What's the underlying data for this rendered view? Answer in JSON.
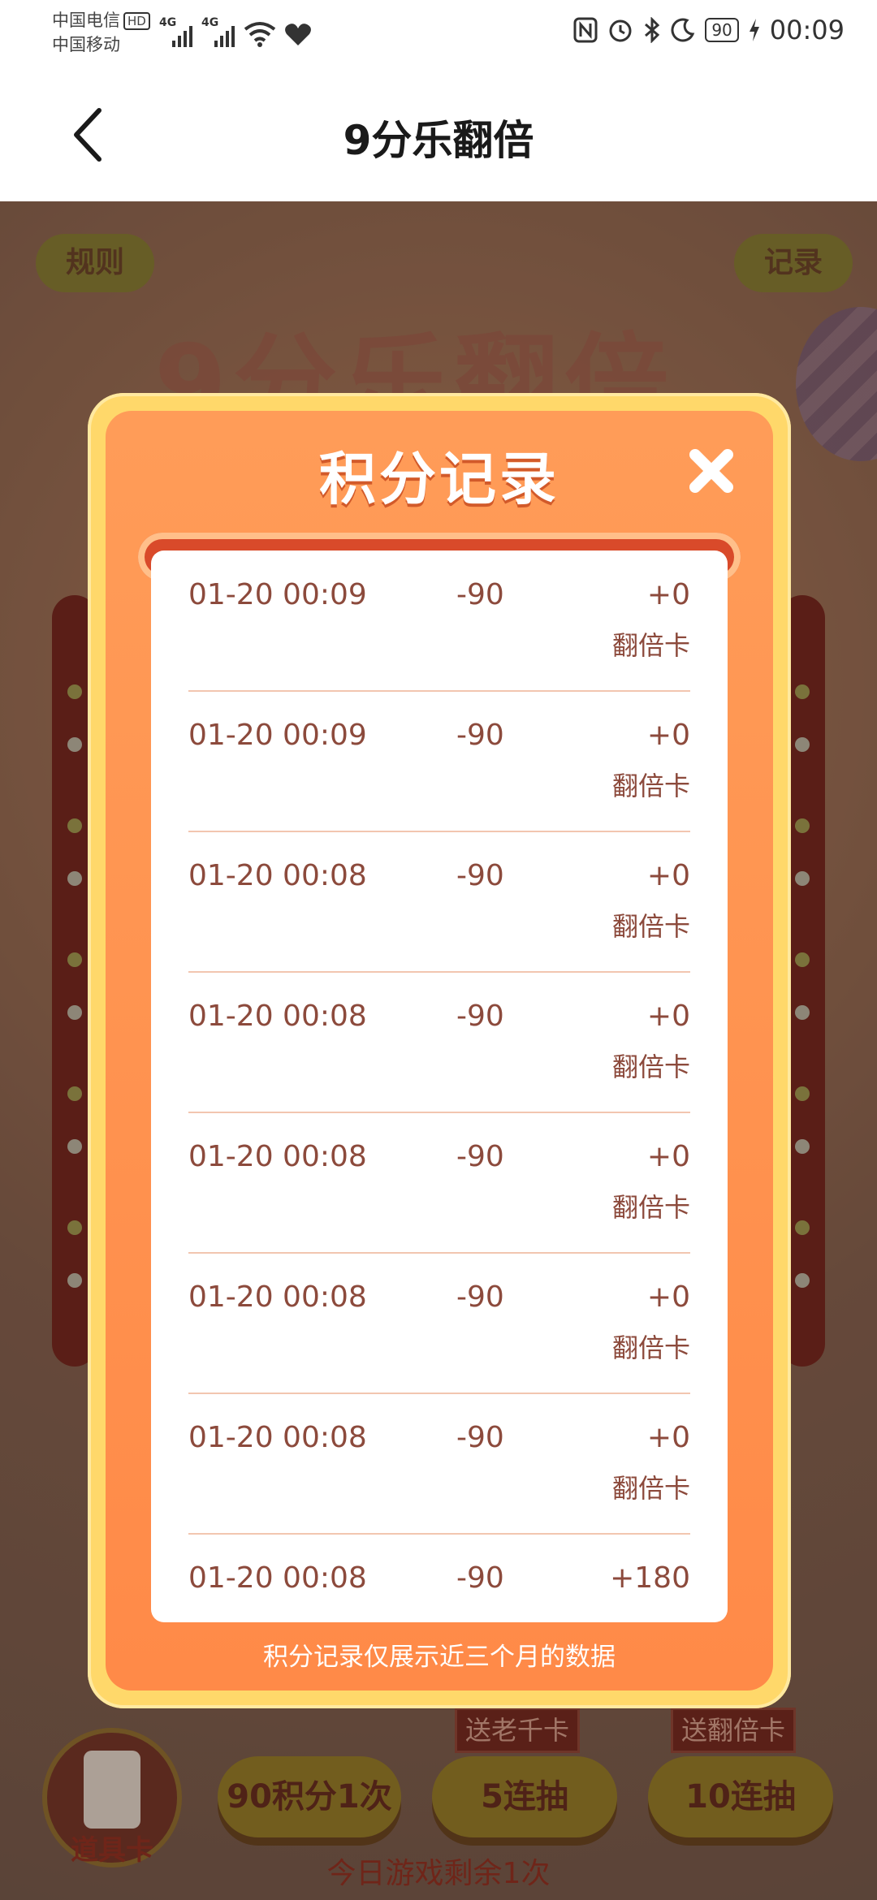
{
  "status_bar": {
    "carrier1": "中国电信",
    "hd": "HD",
    "carrier2": "中国移动",
    "net1": "4G",
    "net2": "4G",
    "battery": "90",
    "time": "00:09"
  },
  "header": {
    "title": "9分乐翻倍"
  },
  "game": {
    "rules_label": "规则",
    "records_label": "记录",
    "title_art": "9分乐翻倍",
    "prop_card_label": "道具卡",
    "btn_single": "90积分1次",
    "btn_five": "5连抽",
    "btn_five_tag": "送老千卡",
    "btn_ten": "10连抽",
    "btn_ten_tag": "送翻倍卡",
    "remaining": "今日游戏剩余1次"
  },
  "modal": {
    "title": "积分记录",
    "footer": "积分记录仅展示近三个月的数据",
    "records": [
      {
        "date": "01-20 00:09",
        "delta": "-90",
        "gain": "+0",
        "kind": "翻倍卡"
      },
      {
        "date": "01-20 00:09",
        "delta": "-90",
        "gain": "+0",
        "kind": "翻倍卡"
      },
      {
        "date": "01-20 00:08",
        "delta": "-90",
        "gain": "+0",
        "kind": "翻倍卡"
      },
      {
        "date": "01-20 00:08",
        "delta": "-90",
        "gain": "+0",
        "kind": "翻倍卡"
      },
      {
        "date": "01-20 00:08",
        "delta": "-90",
        "gain": "+0",
        "kind": "翻倍卡"
      },
      {
        "date": "01-20 00:08",
        "delta": "-90",
        "gain": "+0",
        "kind": "翻倍卡"
      },
      {
        "date": "01-20 00:08",
        "delta": "-90",
        "gain": "+0",
        "kind": "翻倍卡"
      },
      {
        "date": "01-20 00:08",
        "delta": "-90",
        "gain": "+180",
        "kind": ""
      }
    ]
  },
  "colors": {
    "modal_orange": "#ff8a48",
    "modal_border": "#ffd86a",
    "record_text": "#8c4a3c"
  }
}
